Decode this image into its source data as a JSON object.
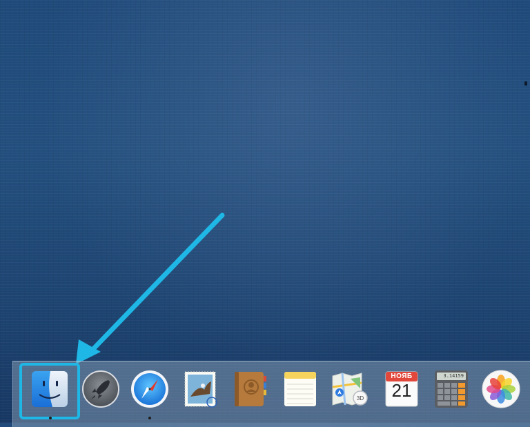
{
  "desktop": {
    "wallpaper": "ocean-water",
    "annotation_color": "#1fb7e6"
  },
  "dock": {
    "items": [
      {
        "id": "finder",
        "icon": "finder-icon",
        "running": true,
        "highlighted": true
      },
      {
        "id": "launchpad",
        "icon": "launchpad-rocket-icon",
        "running": false
      },
      {
        "id": "safari",
        "icon": "safari-compass-icon",
        "running": true
      },
      {
        "id": "mail",
        "icon": "mail-stamp-icon",
        "running": false
      },
      {
        "id": "contacts",
        "icon": "contacts-book-icon",
        "running": false
      },
      {
        "id": "notes",
        "icon": "notes-icon",
        "running": false
      },
      {
        "id": "maps",
        "icon": "maps-icon",
        "running": false
      },
      {
        "id": "calendar",
        "icon": "calendar-icon",
        "running": false,
        "month": "НОЯБ",
        "day": "21"
      },
      {
        "id": "calculator",
        "icon": "calculator-icon",
        "running": false,
        "display": "3.14159"
      },
      {
        "id": "photos",
        "icon": "photos-flower-icon",
        "running": false
      }
    ]
  }
}
